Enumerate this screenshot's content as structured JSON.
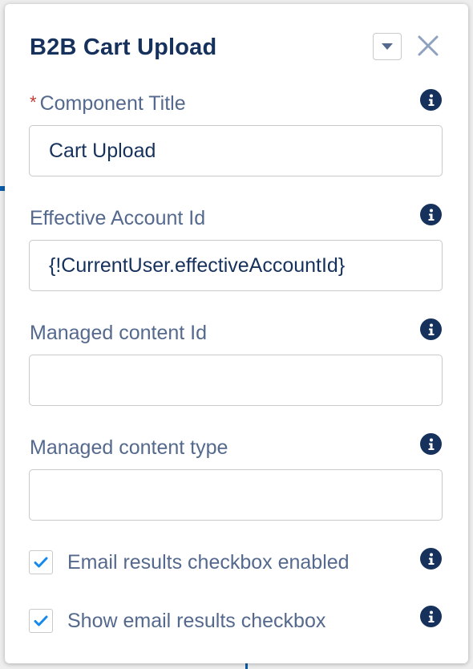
{
  "panel": {
    "title": "B2B Cart Upload",
    "dropdown_icon": "chevron-down-icon",
    "close_icon": "close-icon"
  },
  "fields": [
    {
      "label": "Component Title",
      "required": true,
      "required_marker": "*",
      "value": "Cart Upload",
      "info_icon": "info-icon"
    },
    {
      "label": "Effective Account Id",
      "required": false,
      "value": "{!CurrentUser.effectiveAccountId}",
      "info_icon": "info-icon"
    },
    {
      "label": "Managed content Id",
      "required": false,
      "value": "",
      "info_icon": "info-icon"
    },
    {
      "label": "Managed content type",
      "required": false,
      "value": "",
      "info_icon": "info-icon"
    }
  ],
  "checkboxes": [
    {
      "label": "Email results checkbox enabled",
      "checked": true,
      "info_icon": "info-icon"
    },
    {
      "label": "Show email results checkbox",
      "checked": true,
      "info_icon": "info-icon"
    }
  ],
  "colors": {
    "title": "#16325c",
    "label": "#54698d",
    "required": "#c23934",
    "check": "#1589ee",
    "info_icon_bg": "#16325c",
    "input_border": "#c9c9c9"
  }
}
